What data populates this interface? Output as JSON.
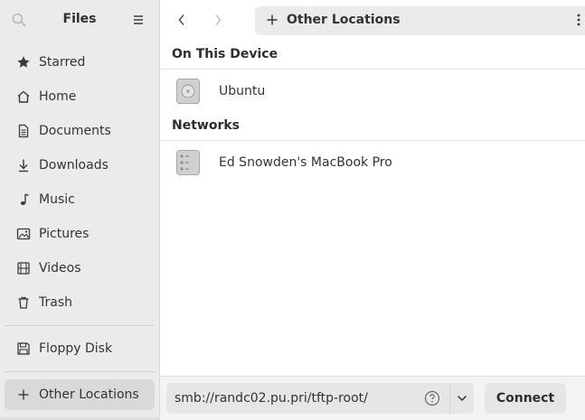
{
  "sidebar": {
    "title": "Files",
    "items": [
      {
        "label": "Starred",
        "icon": "star-icon"
      },
      {
        "label": "Home",
        "icon": "home-icon"
      },
      {
        "label": "Documents",
        "icon": "document-icon"
      },
      {
        "label": "Downloads",
        "icon": "download-icon"
      },
      {
        "label": "Music",
        "icon": "music-note-icon"
      },
      {
        "label": "Pictures",
        "icon": "picture-icon"
      },
      {
        "label": "Videos",
        "icon": "film-icon"
      },
      {
        "label": "Trash",
        "icon": "trash-icon"
      }
    ],
    "devices": [
      {
        "label": "Floppy Disk",
        "icon": "floppy-icon"
      }
    ],
    "other_locations": {
      "label": "Other Locations",
      "icon": "plus-icon",
      "active": true
    }
  },
  "header": {
    "location_label": "Other Locations"
  },
  "sections": {
    "on_this_device": {
      "title": "On This Device",
      "items": [
        {
          "label": "Ubuntu",
          "icon": "hard-drive-icon"
        }
      ]
    },
    "networks": {
      "title": "Networks",
      "items": [
        {
          "label": "Ed Snowden's MacBook Pro",
          "icon": "network-server-icon"
        }
      ]
    }
  },
  "connect_bar": {
    "server_address": "smb://randc02.pu.pri/tftp-root/",
    "connect_label": "Connect"
  },
  "colors": {
    "sidebar_bg": "#ebebeb",
    "active_item_bg": "#d9d9d9",
    "text": "#2e2e2e"
  }
}
